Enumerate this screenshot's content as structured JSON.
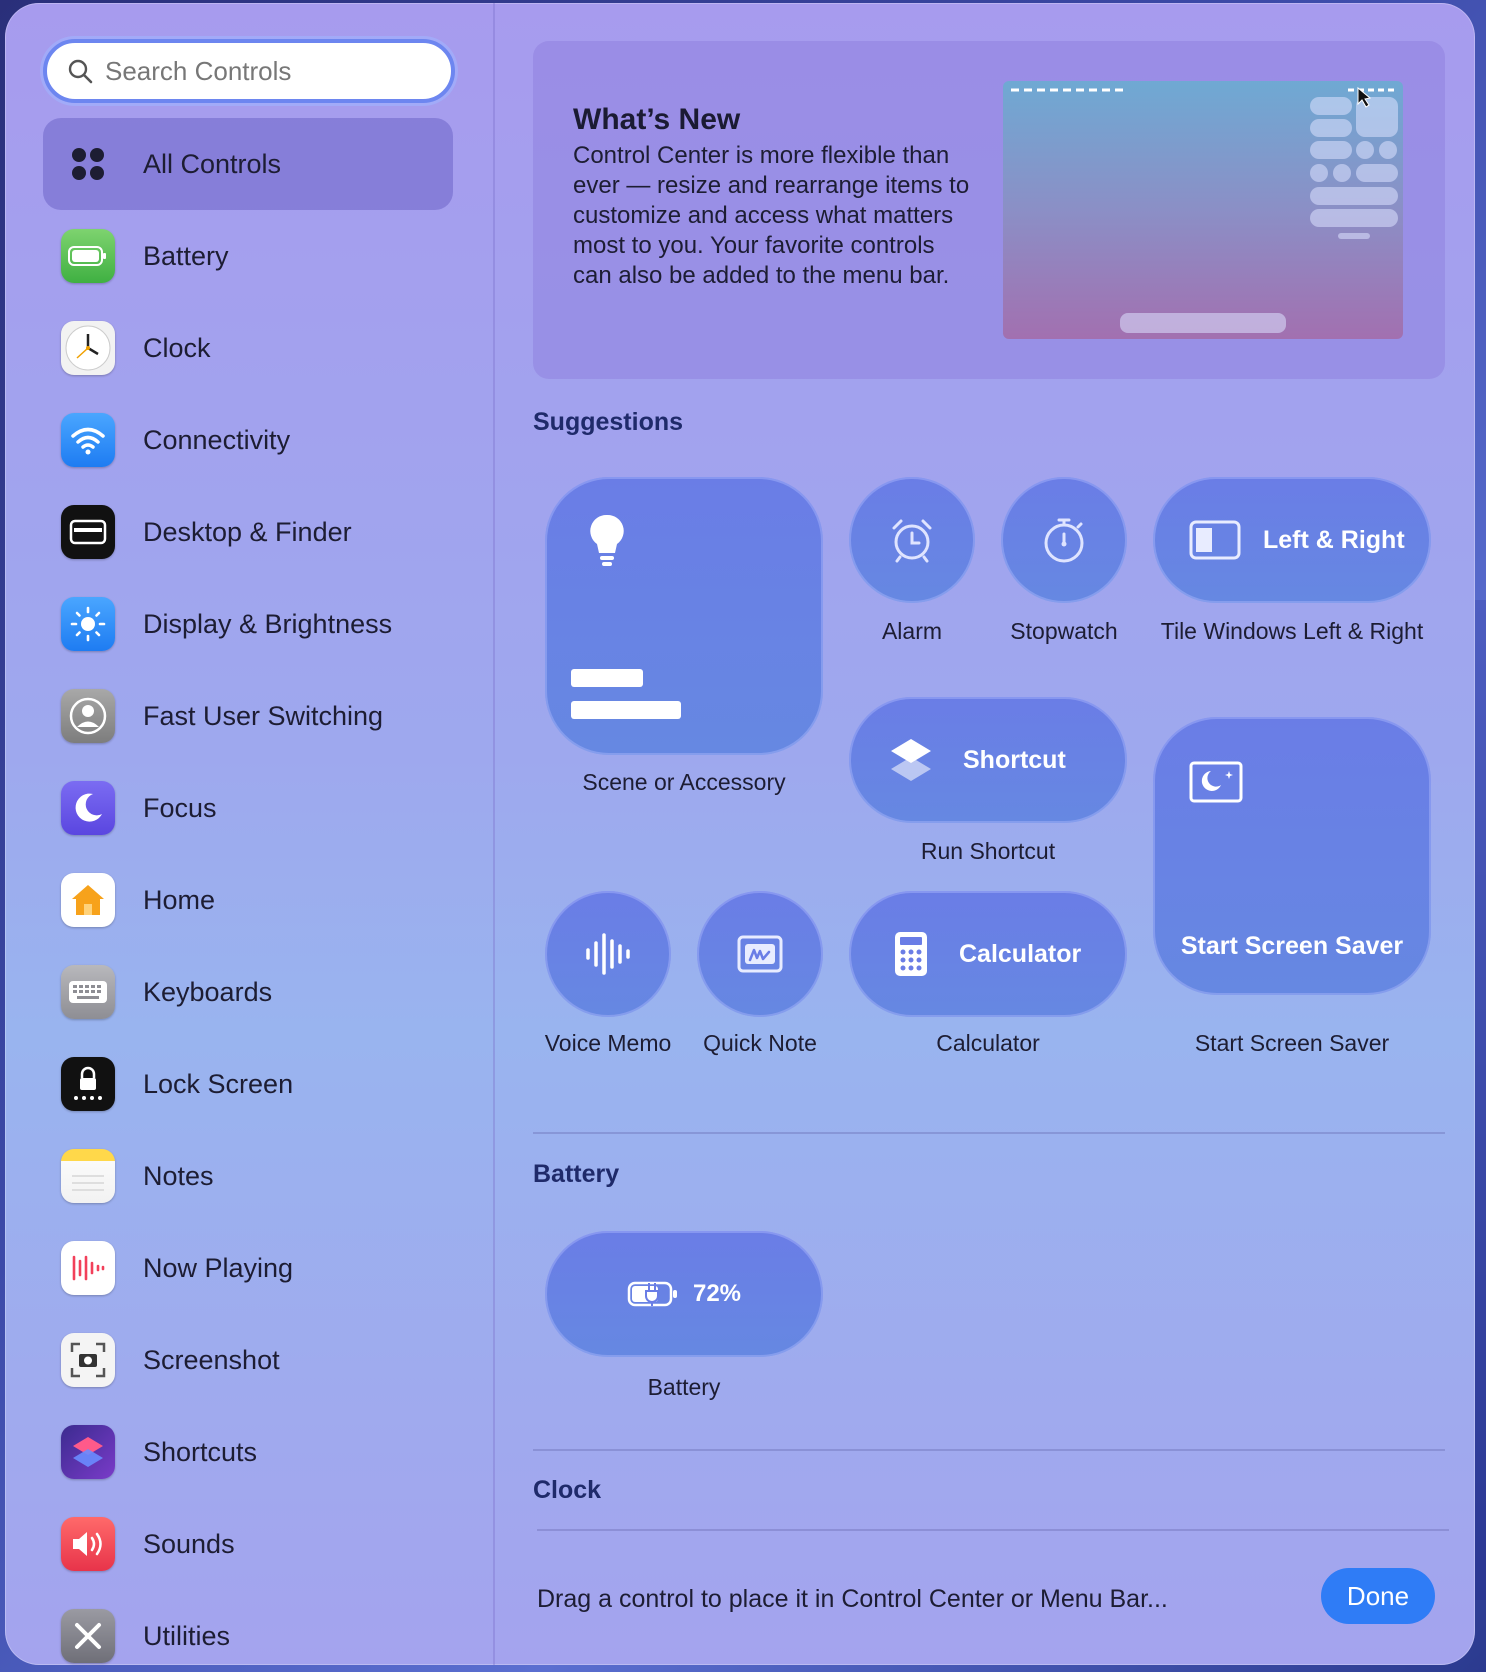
{
  "search": {
    "placeholder": "Search Controls"
  },
  "sidebar": {
    "items": [
      {
        "label": "All Controls",
        "icon": "all-controls-icon",
        "active": true
      },
      {
        "label": "Battery",
        "icon": "battery-icon"
      },
      {
        "label": "Clock",
        "icon": "clock-icon"
      },
      {
        "label": "Connectivity",
        "icon": "wifi-icon"
      },
      {
        "label": "Desktop & Finder",
        "icon": "desktop-icon"
      },
      {
        "label": "Display & Brightness",
        "icon": "brightness-icon"
      },
      {
        "label": "Fast User Switching",
        "icon": "user-icon"
      },
      {
        "label": "Focus",
        "icon": "moon-icon"
      },
      {
        "label": "Home",
        "icon": "home-icon"
      },
      {
        "label": "Keyboards",
        "icon": "keyboard-icon"
      },
      {
        "label": "Lock Screen",
        "icon": "lock-icon"
      },
      {
        "label": "Notes",
        "icon": "notes-icon"
      },
      {
        "label": "Now Playing",
        "icon": "now-playing-icon"
      },
      {
        "label": "Screenshot",
        "icon": "screenshot-icon"
      },
      {
        "label": "Shortcuts",
        "icon": "shortcuts-icon"
      },
      {
        "label": "Sounds",
        "icon": "speaker-icon"
      },
      {
        "label": "Utilities",
        "icon": "utilities-icon"
      }
    ]
  },
  "whats_new": {
    "title": "What’s New",
    "body": "Control Center is more flexible than ever — resize and rearrange items to customize and access what matters most to you. Your favorite controls can also be added to the menu bar."
  },
  "suggestions": {
    "title": "Suggestions",
    "scene": {
      "caption": "Scene or Accessory"
    },
    "alarm": {
      "caption": "Alarm"
    },
    "stopwatch": {
      "caption": "Stopwatch"
    },
    "tile_windows": {
      "label": "Left & Right",
      "caption": "Tile Windows Left & Right"
    },
    "shortcut": {
      "label": "Shortcut",
      "caption": "Run Shortcut"
    },
    "screen_saver": {
      "label": "Start Screen Saver",
      "caption": "Start Screen Saver"
    },
    "voice_memo": {
      "caption": "Voice Memo"
    },
    "quick_note": {
      "caption": "Quick Note"
    },
    "calculator": {
      "label": "Calculator",
      "caption": "Calculator"
    }
  },
  "battery_section": {
    "title": "Battery",
    "tile": {
      "value": "72%",
      "caption": "Battery"
    }
  },
  "clock_section": {
    "title": "Clock"
  },
  "footer": {
    "hint": "Drag a control to place it in Control Center or Menu Bar...",
    "done_label": "Done"
  },
  "colors": {
    "accent": "#2f7cf6",
    "tile": "#6a7de6"
  }
}
